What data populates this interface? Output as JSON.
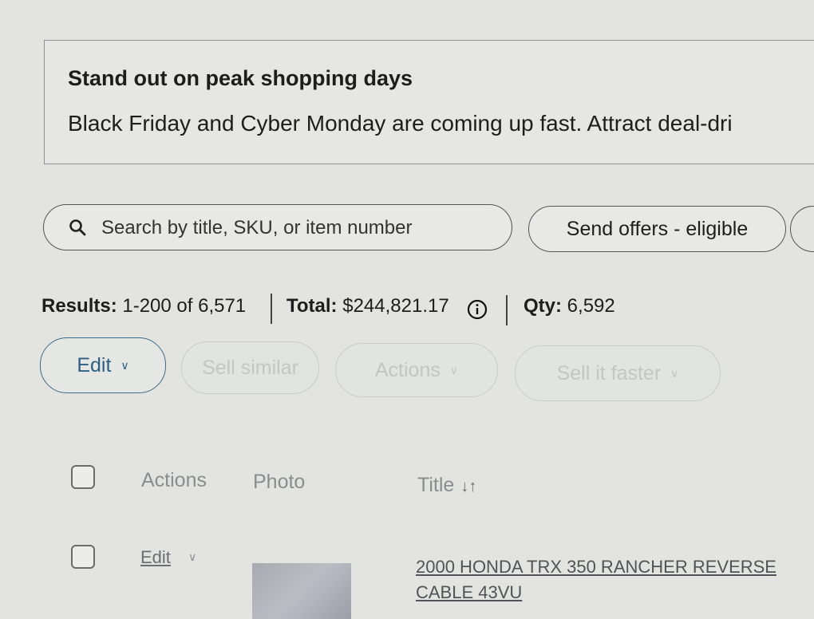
{
  "banner": {
    "title": "Stand out on peak shopping days",
    "text": "Black Friday and Cyber Monday are coming up fast. Attract deal-dri"
  },
  "search": {
    "placeholder": "Search by title, SKU, or item number",
    "icon": "search-icon"
  },
  "offers_button": {
    "label": "Send offers - eligible"
  },
  "summary": {
    "results_label": "Results:",
    "results_value": "1-200 of 6,571",
    "total_label": "Total:",
    "total_value": "$244,821.17",
    "qty_label": "Qty:",
    "qty_value": "6,592"
  },
  "toolbar": {
    "edit": "Edit",
    "sell_similar": "Sell similar",
    "actions": "Actions",
    "sell_faster": "Sell it faster"
  },
  "table": {
    "headers": {
      "actions": "Actions",
      "photo": "Photo",
      "title": "Title"
    },
    "rows": [
      {
        "edit": "Edit",
        "title": "2000 HONDA TRX 350 RANCHER REVERSE CABLE 43VU"
      }
    ]
  },
  "colors": {
    "accent": "#2f5f80",
    "disabled": "#c3c6c3",
    "background": "#e3e4e0"
  }
}
